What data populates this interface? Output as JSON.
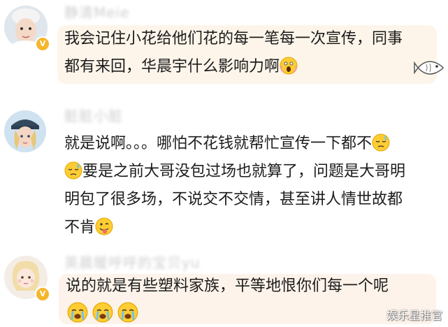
{
  "comments": [
    {
      "username": "静清Meie",
      "lines": [
        [
          "我会记住小花给他们花的每一笔每一次宣传，同事"
        ],
        [
          "都有来回，华晨宇什么影响力啊",
          "emoji:scream"
        ]
      ]
    },
    {
      "username": "脏脏小脏",
      "lines": [
        [
          "就是说啊。。。哪怕不花钱就帮忙宣传一下都不",
          "emoji:sweat"
        ],
        [
          "emoji:sweat",
          "要是之前大哥没包过场也就算了，问题是大哥明"
        ],
        [
          "明包了很多场，不说交不交情，甚至讲人情世故都"
        ],
        [
          "不肯",
          "emoji:tongue"
        ]
      ]
    },
    {
      "username": "英晨暖呼呼的宝贝yu",
      "lines": [
        [
          "说的就是有些塑料家族，平等地恨你们每一个呢"
        ]
      ],
      "reactions": [
        "emoji:cry",
        "emoji:cry",
        "emoji:cry"
      ]
    }
  ],
  "watermark": "娱乐星推官",
  "badge_icon": "verified-badge-icon",
  "colors": {
    "badge": "#f6b62b",
    "bubble1": "#fdf5ea",
    "bubble3": "#fdf3ea",
    "text": "#1c1c1c"
  }
}
